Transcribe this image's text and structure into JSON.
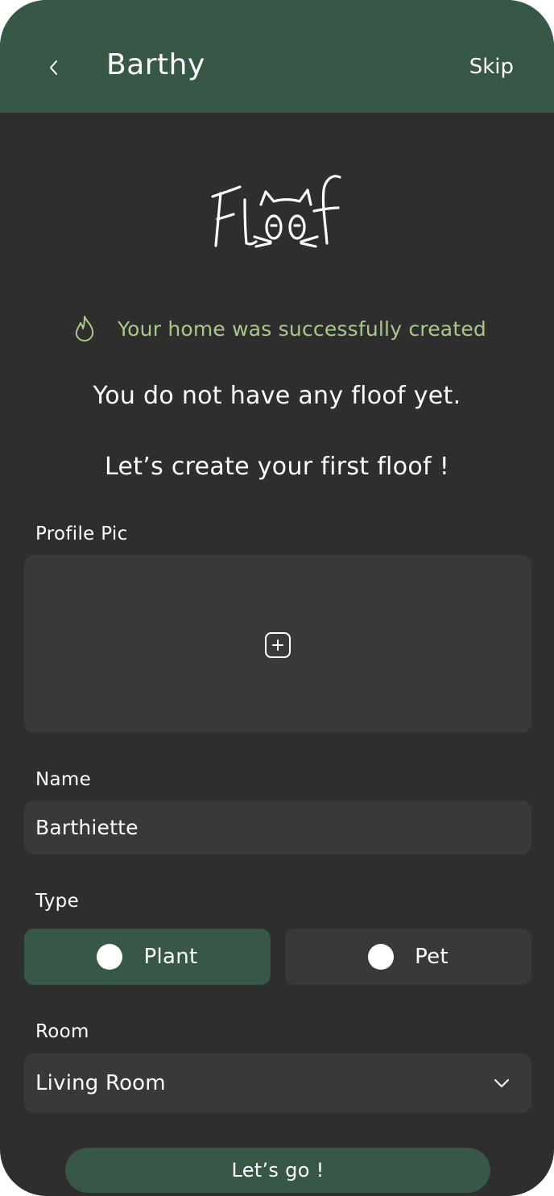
{
  "header": {
    "title": "Barthy",
    "skip_label": "Skip",
    "back_icon": "chevron-left-icon"
  },
  "logo": {
    "text": "Floof"
  },
  "notice": {
    "icon": "flame-icon",
    "text": "Your home was successfully created",
    "color": "#a9c98a"
  },
  "messages": {
    "line1": "You do not have any floof yet.",
    "line2": "Let’s create your first floof !"
  },
  "form": {
    "profile_pic_label": "Profile Pic",
    "add_photo_icon": "add-photo-icon",
    "name_label": "Name",
    "name_value": "Barthiette",
    "type_label": "Type",
    "type_options": [
      {
        "label": "Plant",
        "selected": true
      },
      {
        "label": "Pet",
        "selected": false
      }
    ],
    "room_label": "Room",
    "room_value": "Living Room",
    "submit_label": "Let’s go !"
  },
  "colors": {
    "accent": "#375846",
    "background": "#2e2e2e",
    "field": "#393939",
    "text": "#ffffff"
  }
}
